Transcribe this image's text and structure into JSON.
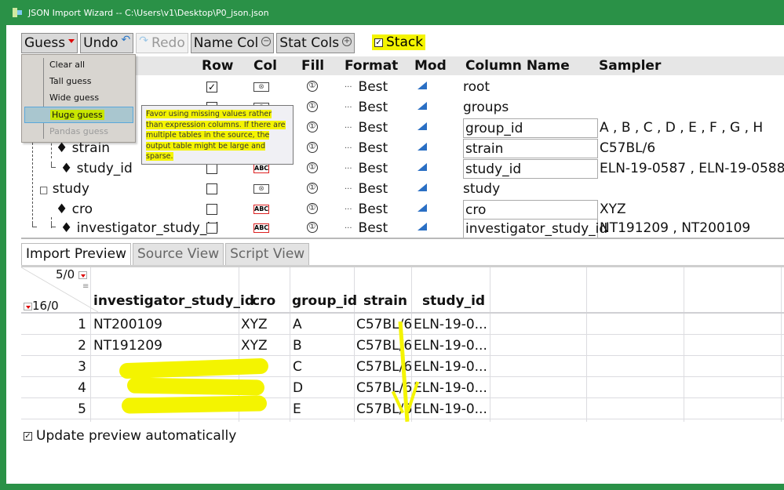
{
  "window": {
    "title": "JSON Import Wizard -- C:\\Users\\v1\\Desktop\\P0_json.json"
  },
  "toolbar": {
    "guess_label": "Guess",
    "undo_label": "Undo",
    "redo_label": "Redo",
    "name_col_label": "Name Col",
    "stat_cols_label": "Stat Cols",
    "stack_label": "Stack",
    "stack_checked": true
  },
  "guess_menu": {
    "items": [
      {
        "label": "Clear all",
        "state": "normal"
      },
      {
        "label": "Tall guess",
        "state": "normal"
      },
      {
        "label": "Wide guess",
        "state": "normal"
      },
      {
        "label": "Huge guess",
        "state": "selected"
      },
      {
        "label": "Pandas guess",
        "state": "disabled"
      }
    ],
    "tooltip": "Favor using missing values rather than expression columns. If there are multiple tables in the source, the output table might be large and sparse."
  },
  "structure_grid": {
    "headers": [
      "Row",
      "Col",
      "Fill",
      "Format",
      "Mod",
      "Column Name",
      "Sampler"
    ],
    "rows": [
      {
        "tree": "root",
        "row_checked": true,
        "col_type": "nested",
        "format": "Best",
        "column_name": "root",
        "sampler": "",
        "editable": false
      },
      {
        "tree": "groups",
        "row_checked": false,
        "col_type": "nested",
        "format": "Best",
        "column_name": "groups",
        "sampler": "",
        "editable": false
      },
      {
        "tree": "group_id",
        "row_checked": false,
        "col_type": "nested",
        "format": "Best",
        "column_name": "group_id",
        "sampler": "A , B , C , D , E , F , G , H",
        "editable": true
      },
      {
        "tree": "strain",
        "row_checked": false,
        "col_type": "nested",
        "format": "Best",
        "column_name": "strain",
        "sampler": "C57BL/6",
        "editable": true
      },
      {
        "tree": "study_id",
        "row_checked": false,
        "col_type": "ABC",
        "format": "Best",
        "column_name": "study_id",
        "sampler": "ELN-19-0587 , ELN-19-0588",
        "editable": true
      },
      {
        "tree": "study",
        "row_checked": false,
        "col_type": "nested",
        "format": "Best",
        "column_name": "study",
        "sampler": "",
        "editable": false
      },
      {
        "tree": "cro",
        "row_checked": false,
        "col_type": "ABC",
        "format": "Best",
        "column_name": "cro",
        "sampler": "XYZ",
        "editable": true
      },
      {
        "tree": "investigator_study_id",
        "row_checked": false,
        "col_type": "ABC",
        "format": "Best",
        "column_name": "investigator_study_id",
        "sampler": "NT191209 , NT200109",
        "editable": true
      }
    ],
    "fill_glyph": "①",
    "format_dots": "···",
    "col_icon_abc": "ABC",
    "col_icon_nested": "⊗"
  },
  "tabs": [
    {
      "label": "Import Preview",
      "active": true
    },
    {
      "label": "Source View",
      "active": false
    },
    {
      "label": "Script View",
      "active": false
    }
  ],
  "preview": {
    "cols_count": "5/0",
    "rows_count": "16/0",
    "headers": [
      "investigator_study_id",
      "cro",
      "group_id",
      "strain",
      "study_id"
    ],
    "rows": [
      {
        "n": "1",
        "cells": [
          "NT200109",
          "XYZ",
          "A",
          "C57BL/6",
          "ELN-19-0..."
        ]
      },
      {
        "n": "2",
        "cells": [
          "NT191209",
          "XYZ",
          "B",
          "C57BL/6",
          "ELN-19-0..."
        ]
      },
      {
        "n": "3",
        "cells": [
          "",
          "",
          "C",
          "C57BL/6",
          "ELN-19-0..."
        ]
      },
      {
        "n": "4",
        "cells": [
          "",
          "",
          "D",
          "C57BL/6",
          "ELN-19-0..."
        ]
      },
      {
        "n": "5",
        "cells": [
          "",
          "",
          "E",
          "C57BL/6",
          "ELN-19-0..."
        ]
      }
    ]
  },
  "update_preview": {
    "label": "Update preview automatically",
    "checked": true
  },
  "colors": {
    "title_bar": "#2a9147",
    "highlight": "#f4f400",
    "menu_selected": "#a9c6cf",
    "mod_icon": "#2a6fc4"
  }
}
